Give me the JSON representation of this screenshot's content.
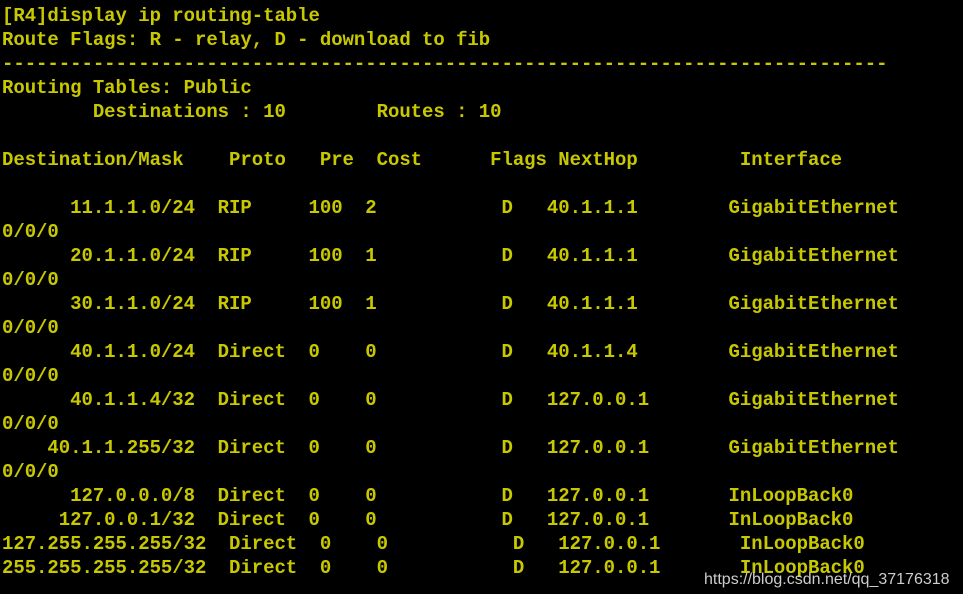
{
  "terminal": {
    "colors": {
      "background": "#000000",
      "foreground": "#c8c800",
      "watermark": "#d9d9d9"
    },
    "prompt_line": "[R4]display ip routing-table",
    "route_flags_line": "Route Flags: R - relay, D - download to fib",
    "separator": "------------------------------------------------------------------------------",
    "routing_tables_line": "Routing Tables: Public",
    "summary_line": "        Destinations : 10        Routes : 10",
    "summary": {
      "destinations_label": "Destinations",
      "destinations_count": "10",
      "routes_label": "Routes",
      "routes_count": "10"
    },
    "header_line": "Destination/Mask    Proto   Pre  Cost      Flags NextHop         Interface",
    "columns": [
      "Destination/Mask",
      "Proto",
      "Pre",
      "Cost",
      "Flags",
      "NextHop",
      "Interface"
    ],
    "rows": [
      {
        "line": "      11.1.1.0/24  RIP     100  2           D   40.1.1.1        GigabitEthernet",
        "wrap": "0/0/0",
        "destination": "11.1.1.0/24",
        "proto": "RIP",
        "pre": "100",
        "cost": "2",
        "flags": "D",
        "nexthop": "40.1.1.1",
        "interface": "GigabitEthernet0/0/0"
      },
      {
        "line": "      20.1.1.0/24  RIP     100  1           D   40.1.1.1        GigabitEthernet",
        "wrap": "0/0/0",
        "destination": "20.1.1.0/24",
        "proto": "RIP",
        "pre": "100",
        "cost": "1",
        "flags": "D",
        "nexthop": "40.1.1.1",
        "interface": "GigabitEthernet0/0/0"
      },
      {
        "line": "      30.1.1.0/24  RIP     100  1           D   40.1.1.1        GigabitEthernet",
        "wrap": "0/0/0",
        "destination": "30.1.1.0/24",
        "proto": "RIP",
        "pre": "100",
        "cost": "1",
        "flags": "D",
        "nexthop": "40.1.1.1",
        "interface": "GigabitEthernet0/0/0"
      },
      {
        "line": "      40.1.1.0/24  Direct  0    0           D   40.1.1.4        GigabitEthernet",
        "wrap": "0/0/0",
        "destination": "40.1.1.0/24",
        "proto": "Direct",
        "pre": "0",
        "cost": "0",
        "flags": "D",
        "nexthop": "40.1.1.4",
        "interface": "GigabitEthernet0/0/0"
      },
      {
        "line": "      40.1.1.4/32  Direct  0    0           D   127.0.0.1       GigabitEthernet",
        "wrap": "0/0/0",
        "destination": "40.1.1.4/32",
        "proto": "Direct",
        "pre": "0",
        "cost": "0",
        "flags": "D",
        "nexthop": "127.0.0.1",
        "interface": "GigabitEthernet0/0/0"
      },
      {
        "line": "    40.1.1.255/32  Direct  0    0           D   127.0.0.1       GigabitEthernet",
        "wrap": "0/0/0",
        "destination": "40.1.1.255/32",
        "proto": "Direct",
        "pre": "0",
        "cost": "0",
        "flags": "D",
        "nexthop": "127.0.0.1",
        "interface": "GigabitEthernet0/0/0"
      },
      {
        "line": "      127.0.0.0/8  Direct  0    0           D   127.0.0.1       InLoopBack0",
        "wrap": "",
        "destination": "127.0.0.0/8",
        "proto": "Direct",
        "pre": "0",
        "cost": "0",
        "flags": "D",
        "nexthop": "127.0.0.1",
        "interface": "InLoopBack0"
      },
      {
        "line": "     127.0.0.1/32  Direct  0    0           D   127.0.0.1       InLoopBack0",
        "wrap": "",
        "destination": "127.0.0.1/32",
        "proto": "Direct",
        "pre": "0",
        "cost": "0",
        "flags": "D",
        "nexthop": "127.0.0.1",
        "interface": "InLoopBack0"
      },
      {
        "line": "127.255.255.255/32  Direct  0    0           D   127.0.0.1       InLoopBack0",
        "wrap": "",
        "destination": "127.255.255.255/32",
        "proto": "Direct",
        "pre": "0",
        "cost": "0",
        "flags": "D",
        "nexthop": "127.0.0.1",
        "interface": "InLoopBack0"
      },
      {
        "line": "255.255.255.255/32  Direct  0    0           D   127.0.0.1       InLoopBack0",
        "wrap": "",
        "destination": "255.255.255.255/32",
        "proto": "Direct",
        "pre": "0",
        "cost": "0",
        "flags": "D",
        "nexthop": "127.0.0.1",
        "interface": "InLoopBack0"
      }
    ]
  },
  "watermark": {
    "text": "https://blog.csdn.net/qq_37176318"
  }
}
